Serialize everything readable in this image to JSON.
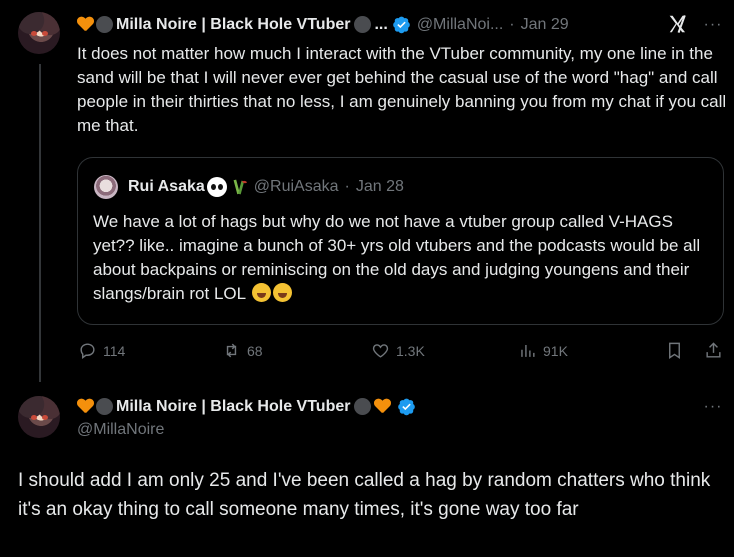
{
  "post1": {
    "author_name": "Milla Noire | Black Hole VTuber",
    "ellipsis": "...",
    "handle": "@MillaNoi...",
    "separator": "·",
    "date": "Jan 29",
    "more": "···",
    "text": "It does not matter how much I interact with the VTuber community, my one line in the sand will be that I will never ever get behind the casual use of the word \"hag\" and call people in their thirties that no less, I am genuinely banning you from my chat if you call me that.",
    "quote": {
      "author_name": "Rui Asaka",
      "handle": "@RuiAsaka",
      "separator": "·",
      "date": "Jan 28",
      "text": "We have a lot of hags but why do we not have a vtuber group called V-HAGS yet?? like.. imagine a bunch of 30+ yrs old vtubers and the podcasts would be all about backpains or reminiscing on the old days and judging youngens and their slangs/brain rot LOL"
    },
    "actions": {
      "replies": "114",
      "reposts": "68",
      "likes": "1.3K",
      "views": "91K"
    }
  },
  "post2": {
    "author_name": "Milla Noire | Black Hole VTuber",
    "handle": "@MillaNoire",
    "more": "···",
    "text": "I should add I am only 25 and I've been called a hag by random chatters who think it's an okay thing to call someone many times, it's gone way too far"
  },
  "colors": {
    "background": "#000000",
    "text": "#e7e9ea",
    "muted": "#71767b",
    "border": "#2f3336",
    "verified": "#1d9bf0",
    "heart": "#f4900c"
  }
}
